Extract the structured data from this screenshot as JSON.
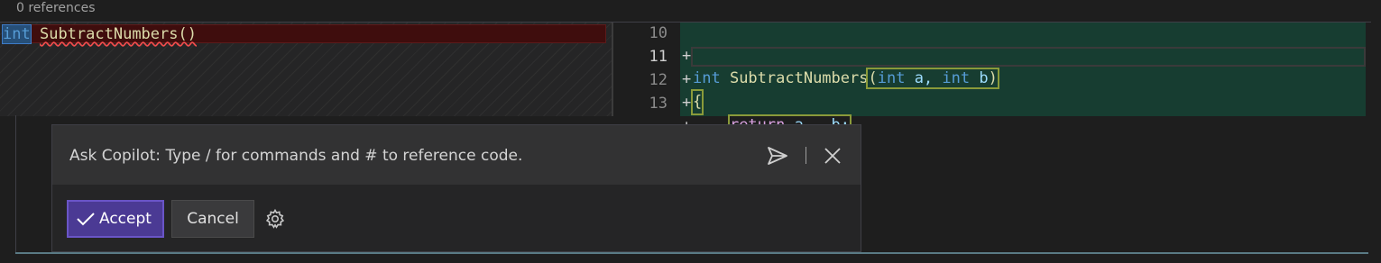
{
  "codelens": {
    "references": "0 references"
  },
  "original": {
    "tokens": {
      "kw": "int",
      "space": " ",
      "fn": "SubtractNumbers",
      "parens": "()"
    }
  },
  "modified": {
    "line_numbers": [
      "10",
      "11",
      "12",
      "13"
    ],
    "lines": [
      {
        "plus": "+",
        "t1": "int",
        "t2": " SubtractNumbers",
        "t3": "(",
        "t4": "int",
        "t5": " a, ",
        "t6": "int",
        "t7": " b",
        "t8": ")"
      },
      {
        "plus": "+",
        "t1": "{"
      },
      {
        "plus": "+",
        "indent": "    ",
        "t1": "return",
        "t2": " a - b;"
      },
      {
        "plus": "+",
        "t1": "}",
        "t2": ")"
      }
    ],
    "current_line": "11"
  },
  "copilot": {
    "placeholder": "Ask Copilot: Type / for commands and # to reference code.",
    "accept_label": "Accept",
    "cancel_label": "Cancel",
    "icons": {
      "send": "send-icon",
      "close": "close-icon",
      "settings": "gear-icon",
      "accept": "checkmark-icon"
    }
  },
  "colors": {
    "added_background": "#173d31",
    "removed_background": "#3f0d0d",
    "accept_button": "#4b3a94",
    "keyword": "#569cd6",
    "function": "#dcdcaa",
    "identifier": "#9cdcfe"
  }
}
